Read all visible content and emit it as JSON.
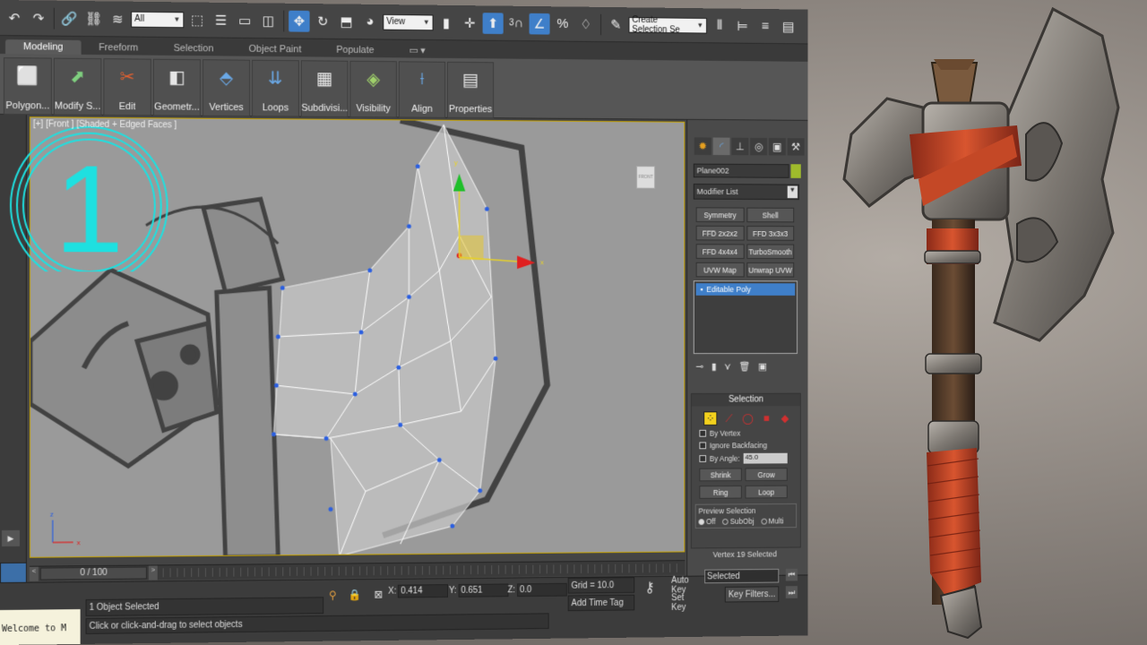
{
  "toolbar": {
    "selection_filter": "All",
    "ref_coord": "View",
    "named_selection_placeholder": "Create Selection Se",
    "snap_label": "3"
  },
  "ribbon": {
    "tabs": [
      "Modeling",
      "Freeform",
      "Selection",
      "Object Paint",
      "Populate"
    ],
    "buttons": [
      "Polygon...",
      "Modify S...",
      "Edit",
      "Geometr...",
      "Vertices",
      "Loops",
      "Subdivisi...",
      "Visibility",
      "Align",
      "Properties"
    ]
  },
  "viewport": {
    "label": "[+] [Front ] [Shaded + Edged Faces ]",
    "overlay_number": "1",
    "viewcube_label": "FRONT",
    "axis_labels": [
      "x",
      "y",
      "z"
    ]
  },
  "command_panel": {
    "object_name": "Plane002",
    "modifier_list": "Modifier List",
    "modifiers": [
      "Symmetry",
      "Shell",
      "FFD 2x2x2",
      "FFD 3x3x3",
      "FFD 4x4x4",
      "TurboSmooth",
      "UVW Map",
      "Unwrap UVW"
    ],
    "stack_item": "Editable Poly",
    "selection_title": "Selection",
    "by_vertex": "By Vertex",
    "ignore_backfacing": "Ignore Backfacing",
    "by_angle": "By Angle:",
    "angle_value": "45.0",
    "shrink": "Shrink",
    "grow": "Grow",
    "ring": "Ring",
    "loop": "Loop",
    "preview_title": "Preview Selection",
    "preview_options": [
      "Off",
      "SubObj",
      "Multi"
    ],
    "status": "Vertex 19 Selected"
  },
  "timeline": {
    "frame": "0 / 100"
  },
  "status": {
    "object_selected": "1 Object Selected",
    "prompt": "Click or click-and-drag to select objects",
    "listener": "Welcome to M",
    "x_label": "X:",
    "x": "0.414",
    "y_label": "Y:",
    "y": "0.651",
    "z_label": "Z:",
    "z": "0.0",
    "grid": "Grid = 10.0",
    "add_time_tag": "Add Time Tag",
    "auto_key": "Auto Key",
    "set_key": "Set Key",
    "key_mode": "Selected",
    "key_filters": "Key Filters..."
  },
  "colors": {
    "accent": "#3f7fc9",
    "overlay_cyan": "#1ee0e0",
    "wrap_orange": "#c8492a",
    "metal": "#8f8a83"
  }
}
